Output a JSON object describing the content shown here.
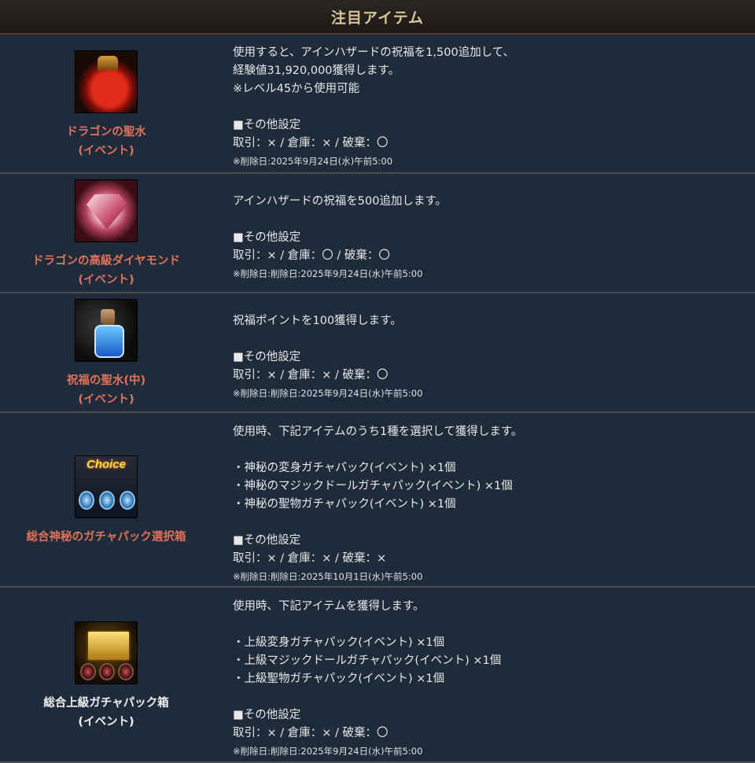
{
  "header": {
    "title": "注目アイテム"
  },
  "items": [
    {
      "icon": "dragon-holy-water-icon",
      "name_lines": [
        "ドラゴンの聖水",
        "(イベント)"
      ],
      "name_color": "#e0715a",
      "lines": [
        "使用すると、アインハザードの祝福を1,500追加して、",
        "経験値31,920,000獲得します。",
        "※レベル45から使用可能",
        "",
        "■その他設定",
        "取引：× / 倉庫：× / 破棄：〇"
      ],
      "note": "※削除日:2025年9月24日(水)午前5:00"
    },
    {
      "icon": "dragon-diamond-icon",
      "name_lines": [
        "ドラゴンの高級ダイヤモンド",
        "(イベント)"
      ],
      "name_color": "#e0715a",
      "lines": [
        "アインハザードの祝福を500追加します。",
        "",
        "■その他設定",
        "取引：× / 倉庫：〇 / 破棄：〇"
      ],
      "note": "※削除日:削除日:2025年9月24日(水)午前5:00"
    },
    {
      "icon": "blessing-holy-water-icon",
      "name_lines": [
        "祝福の聖水(中)",
        "(イベント)"
      ],
      "name_color": "#e0715a",
      "lines": [
        "祝福ポイントを100獲得します。",
        "",
        "■その他設定",
        "取引：× / 倉庫：× / 破棄：〇"
      ],
      "note": "※削除日:削除日:2025年9月24日(水)午前5:00"
    },
    {
      "icon": "choice-box-icon",
      "icon_text": "Choice",
      "name_lines": [
        "総合神秘のガチャパック選択箱"
      ],
      "name_color": "#e0715a",
      "lines": [
        "使用時、下記アイテムのうち1種を選択して獲得します。",
        "",
        "・神秘の変身ガチャパック(イベント) ×1個",
        "・神秘のマジックドールガチャパック(イベント) ×1個",
        "・神秘の聖物ガチャパック(イベント) ×1個",
        "",
        "■その他設定",
        "取引：× / 倉庫：× / 破棄：×"
      ],
      "note": "※削除日:削除日:2025年10月1日(水)午前5:00"
    },
    {
      "icon": "treasure-chest-icon",
      "name_lines": [
        "総合上級ガチャパック箱",
        "(イベント)"
      ],
      "name_color": "#f0f0f0",
      "lines": [
        "使用時、下記アイテムを獲得します。",
        "",
        "・上級変身ガチャパック(イベント) ×1個",
        "・上級マジックドールガチャパック(イベント) ×1個",
        "・上級聖物ガチャパック(イベント) ×1個",
        "",
        "■その他設定",
        "取引：× / 倉庫：× / 破棄：〇"
      ],
      "note": "※削除日:削除日:2025年9月24日(水)午前5:00"
    }
  ]
}
